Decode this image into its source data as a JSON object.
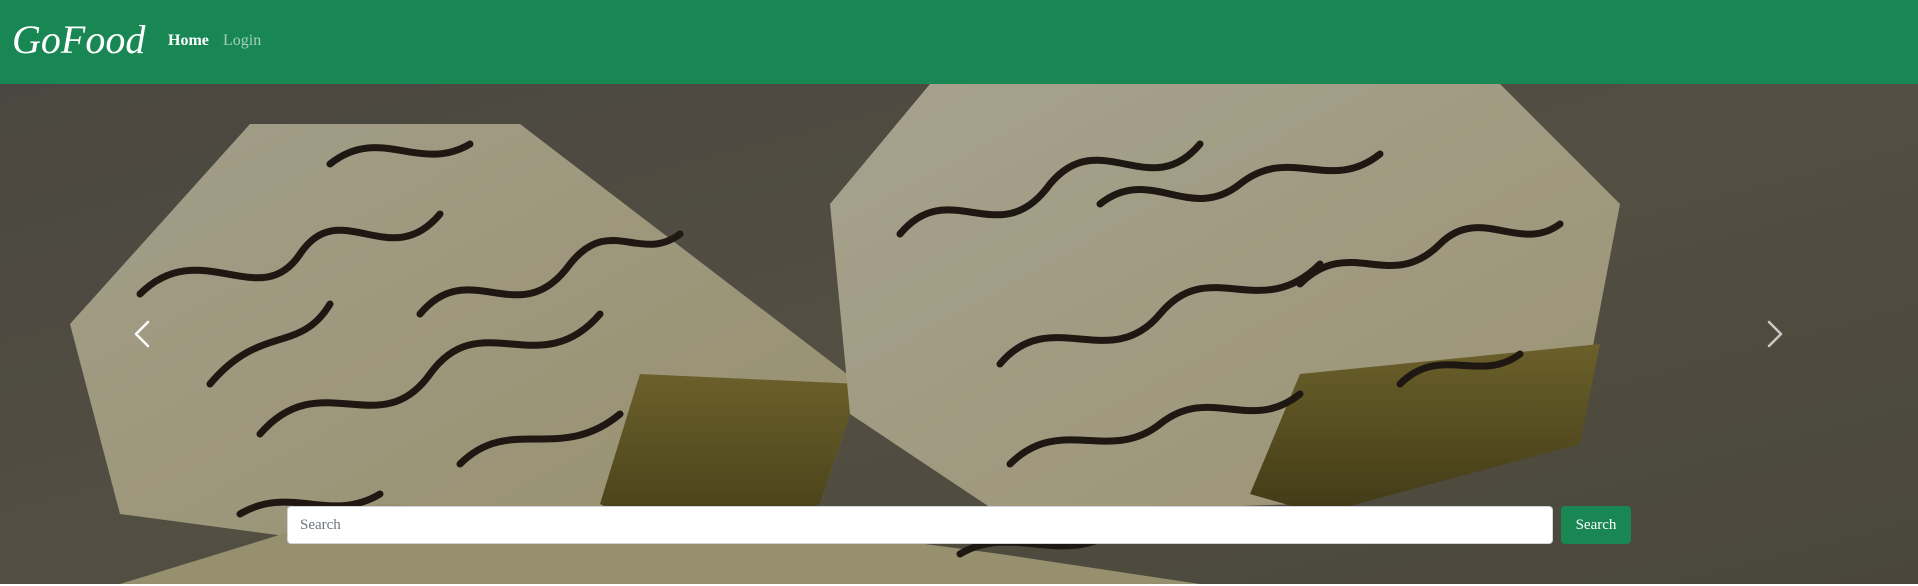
{
  "navbar": {
    "brand": "GoFood",
    "links": [
      {
        "label": "Home",
        "active": true
      },
      {
        "label": "Login",
        "active": false
      }
    ],
    "background_color": "#198754"
  },
  "carousel": {
    "slide_image": "dessert-cake-slices",
    "prev_icon": "chevron-left-icon",
    "next_icon": "chevron-right-icon"
  },
  "search": {
    "placeholder": "Search",
    "value": "",
    "button_label": "Search",
    "button_color": "#198754"
  }
}
